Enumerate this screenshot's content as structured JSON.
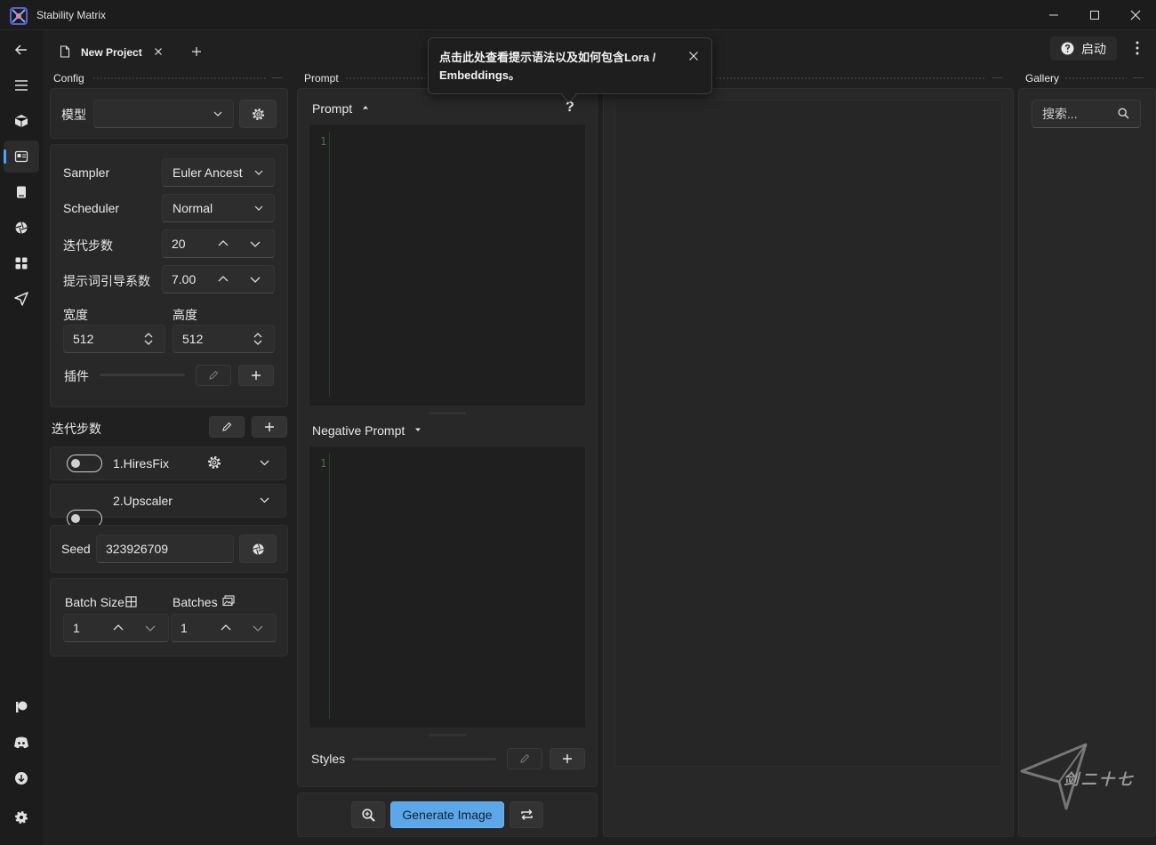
{
  "window": {
    "title": "Stability Matrix"
  },
  "tabs": [
    {
      "label": "New Project"
    }
  ],
  "toolbar": {
    "launch_label": "启动"
  },
  "sections": {
    "config": "Config",
    "prompt": "Prompt",
    "gallery": "Gallery"
  },
  "config": {
    "model_label": "模型",
    "model_value": "",
    "sampler_label": "Sampler",
    "sampler_value": "Euler Ancest",
    "scheduler_label": "Scheduler",
    "scheduler_value": "Normal",
    "steps_label": "迭代步数",
    "steps_value": "20",
    "cfg_label": "提示词引导系数",
    "cfg_value": "7.00",
    "width_label": "宽度",
    "width_value": "512",
    "height_label": "高度",
    "height_value": "512",
    "plugins_label": "插件",
    "steps_section_label": "迭代步数",
    "addons": [
      {
        "label": "1.HiresFix",
        "enabled": false
      },
      {
        "label": "2.Upscaler",
        "enabled": false
      }
    ],
    "seed_label": "Seed",
    "seed_value": "323926709",
    "batch_size_label": "Batch Size",
    "batch_size_value": "1",
    "batches_label": "Batches",
    "batches_value": "1"
  },
  "prompt": {
    "prompt_label": "Prompt",
    "prompt_line": "1",
    "help_glyph": "?",
    "negative_label": "Negative Prompt",
    "negative_line": "1",
    "styles_label": "Styles"
  },
  "tooltip": {
    "text": "点击此处查看提示语法以及如何包含Lora / Embeddings。"
  },
  "actions": {
    "generate_label": "Generate Image"
  },
  "gallery": {
    "search_placeholder": "搜索..."
  },
  "watermark": {
    "text": "剑二十七"
  },
  "colors": {
    "accent": "#5ba7e8",
    "background": "#202020",
    "panel": "#282828"
  }
}
